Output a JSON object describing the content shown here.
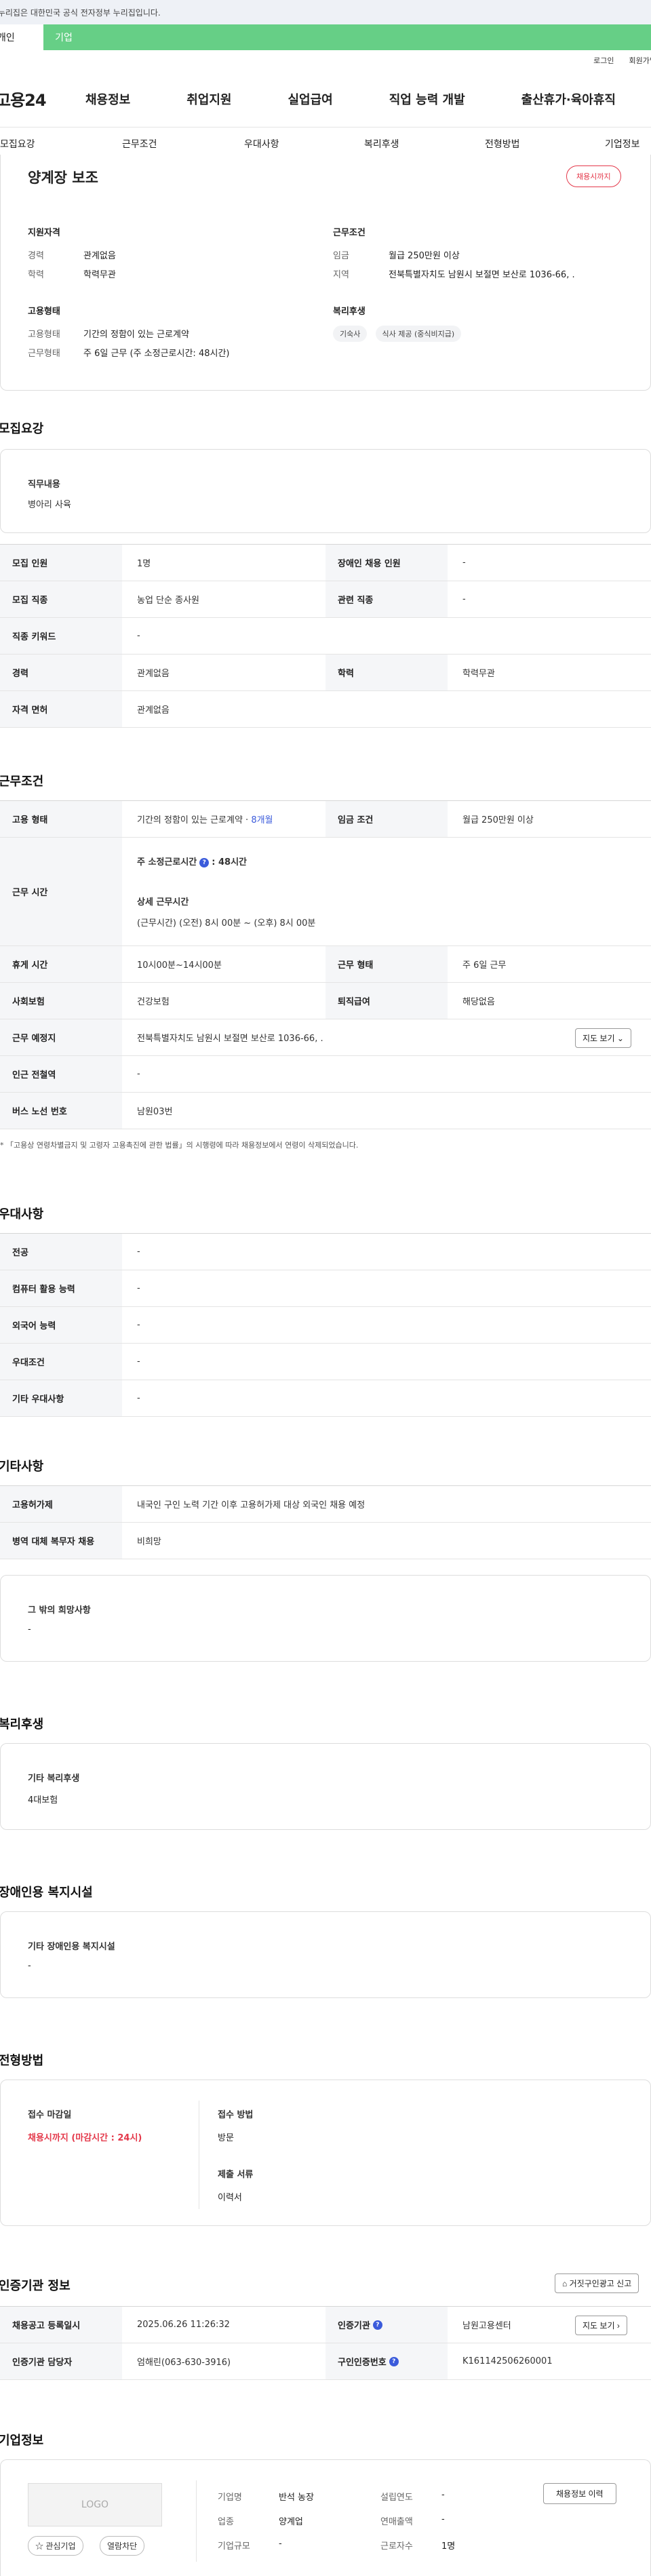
{
  "gov_banner": "이 누리집은 대한민국 공식 전자정부 누리집입니다.",
  "top_tabs": {
    "personal": "개인",
    "company": "기업"
  },
  "util_links": {
    "login": "로그인",
    "signup": "회원가입"
  },
  "site_logo": "고용24",
  "main_nav": [
    "채용정보",
    "취업지원",
    "실업급여",
    "직업 능력 개발",
    "출산휴가·육아휴직"
  ],
  "section_nav": [
    "모집요강",
    "근무조건",
    "우대사항",
    "복리후생",
    "전형방법",
    "기업정보"
  ],
  "summary": {
    "job_title": "양계장 보조",
    "status_badge": "채용시까지",
    "qualification": {
      "heading": "지원자격",
      "rows": [
        [
          "경력",
          "관계없음"
        ],
        [
          "학력",
          "학력무관"
        ]
      ]
    },
    "conditions": {
      "heading": "근무조건",
      "rows": [
        [
          "임금",
          "월급 250만원 이상"
        ],
        [
          "지역",
          "전북특별자치도 남원시 보절면 보산로 1036-66, ."
        ]
      ]
    },
    "employment": {
      "heading": "고용형태",
      "rows": [
        [
          "고용형태",
          "기간의 정함이 있는 근로계약"
        ],
        [
          "근무형태",
          "주 6일 근무 (주 소정근로시간: 48시간)"
        ]
      ]
    },
    "welfare": {
      "heading": "복리후생",
      "chips": [
        "기숙사",
        "식사 제공 (중식비지급)"
      ]
    }
  },
  "recruit": {
    "title": "모집요강",
    "duty_heading": "직무내용",
    "duty_text": "병아리 사육",
    "table": [
      [
        [
          "모집 인원",
          "1명"
        ],
        [
          "장애인 채용 인원",
          "-"
        ]
      ],
      [
        [
          "모집 직종",
          "농업 단순 종사원"
        ],
        [
          "관련 직종",
          "-"
        ]
      ],
      [
        [
          "직종 키워드",
          "-"
        ]
      ],
      [
        [
          "경력",
          "관계없음"
        ],
        [
          "학력",
          "학력무관"
        ]
      ],
      [
        [
          "자격 면허",
          "관계없음"
        ]
      ]
    ]
  },
  "work": {
    "title": "근무조건",
    "employment_type_label": "고용 형태",
    "employment_type_value": "기간의 정함이 있는 근로계약 ·",
    "employment_period": "8개월",
    "wage_label": "임금 조건",
    "wage_value": "월급 250만원 이상",
    "hours_label": "근무 시간",
    "hours_weekly_label": "주 소정근로시간",
    "hours_weekly_value": ": 48시간",
    "hours_detail_label": "상세 근무시간",
    "hours_detail_value": "(근무시간) (오전) 8시 00분 ~ (오후) 8시 00분",
    "break_label": "휴게 시간",
    "break_value": "10시00분~14시00분",
    "shift_label": "근무 형태",
    "shift_value": "주 6일 근무",
    "insurance_label": "사회보험",
    "insurance_value": "건강보험",
    "severance_label": "퇴직급여",
    "severance_value": "해당없음",
    "location_label": "근무 예정지",
    "location_value": "전북특별자치도 남원시 보절면 보산로 1036-66, .",
    "map_button": "지도 보기 ⌄",
    "station_label": "인근 전철역",
    "station_value": "-",
    "bus_label": "버스 노선 번호",
    "bus_value": "남원03번",
    "note": "* 「고용상 연령차별금지 및 고령자 고용촉진에 관한 법률」의 시행령에 따라 채용정보에서 연령이 삭제되었습니다."
  },
  "preference": {
    "title": "우대사항",
    "rows": [
      [
        "전공",
        "-"
      ],
      [
        "컴퓨터 활용 능력",
        "-"
      ],
      [
        "외국어 능력",
        "-"
      ],
      [
        "우대조건",
        "-"
      ],
      [
        "기타 우대사항",
        "-"
      ]
    ]
  },
  "other": {
    "title": "기타사항",
    "rows": [
      [
        "고용허가제",
        "내국인 구인 노력 기간 이후 고용허가제 대상 외국인 채용 예정"
      ],
      [
        "병역 대체 복무자 채용",
        "비희망"
      ]
    ],
    "wish_heading": "그 밖의 희망사항",
    "wish_value": "-"
  },
  "benefits": {
    "title": "복리후생",
    "heading": "기타 복리후생",
    "value": "4대보험"
  },
  "disability": {
    "title": "장애인용 복지시설",
    "heading": "기타 장애인용 복지시설",
    "value": "-"
  },
  "selection": {
    "title": "전형방법",
    "deadline_heading": "접수 마감일",
    "deadline_value": "채용시까지 (마감시간 : 24시)",
    "method_heading": "접수 방법",
    "method_value": "방문",
    "docs_heading": "제출 서류",
    "docs_value": "이력서"
  },
  "cert": {
    "title": "인증기관 정보",
    "report_button": "거짓구인광고 신고",
    "reg_label": "채용공고 등록일시",
    "reg_value": "2025.06.26 11:26:32",
    "agency_label": "인증기관",
    "agency_value": "남원고용센터",
    "map_button": "지도 보기 ›",
    "manager_label": "인증기관 담당자",
    "manager_value": "엄해린(063-630-3916)",
    "cert_no_label": "구인인증번호",
    "cert_no_value": "K161142506260001"
  },
  "company": {
    "title": "기업정보",
    "logo_text": "LOGO",
    "interest_button": "☆ 관심기업",
    "hide_button": "열람차단",
    "info_button": "채용정보 이력",
    "left": [
      [
        "기업명",
        "반석 농장"
      ],
      [
        "업종",
        "양계업"
      ],
      [
        "기업규모",
        "-"
      ]
    ],
    "right": [
      [
        "설립연도",
        "-"
      ],
      [
        "연매출액",
        "-"
      ],
      [
        "근로자수",
        "1명"
      ]
    ]
  },
  "colors": {
    "brand_green": "#66cf86",
    "alert_red": "#e4394b",
    "link_blue": "#3b5bdb"
  }
}
